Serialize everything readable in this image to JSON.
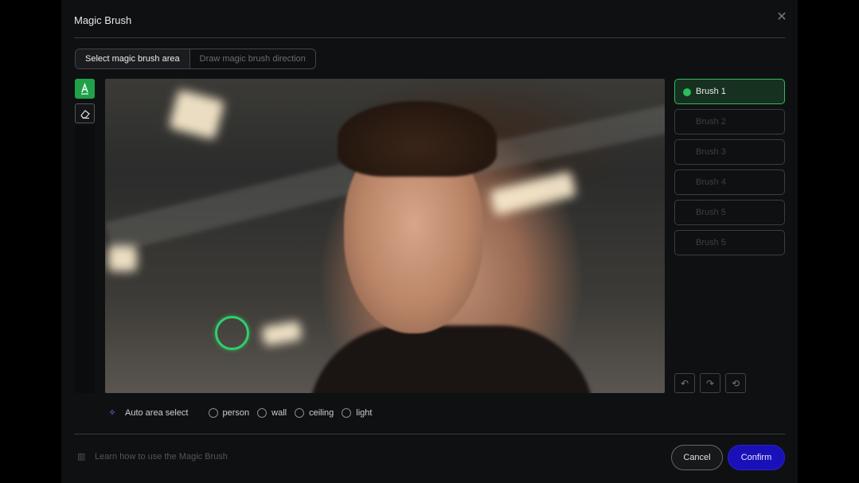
{
  "dialog": {
    "title": "Magic Brush",
    "close_icon": "close-icon"
  },
  "mode_tabs": [
    {
      "label": "Select magic brush area",
      "active": true
    },
    {
      "label": "Draw magic brush direction",
      "active": false
    }
  ],
  "tools": [
    {
      "icon": "brush-icon",
      "active": true
    },
    {
      "icon": "eraser-icon",
      "active": false
    }
  ],
  "brushes": [
    {
      "label": "Brush 1",
      "active": true
    },
    {
      "label": "Brush 2",
      "active": false
    },
    {
      "label": "Brush 3",
      "active": false
    },
    {
      "label": "Brush 4",
      "active": false
    },
    {
      "label": "Brush 5",
      "active": false
    },
    {
      "label": "Brush 5",
      "active": false
    }
  ],
  "history": {
    "undo_icon": "undo-icon",
    "redo_icon": "redo-icon",
    "reset_icon": "reset-icon"
  },
  "auto_select": {
    "label": "Auto area select",
    "icon": "magic-wand-icon",
    "options": [
      "person",
      "wall",
      "ceiling",
      "light"
    ]
  },
  "footer": {
    "learn_label": "Learn how to use the Magic Brush",
    "learn_icon": "book-icon",
    "cancel_label": "Cancel",
    "confirm_label": "Confirm"
  },
  "colors": {
    "accent_green": "#2ebd5b",
    "confirm_blue": "#1a10b8",
    "background": "#0f1012"
  }
}
